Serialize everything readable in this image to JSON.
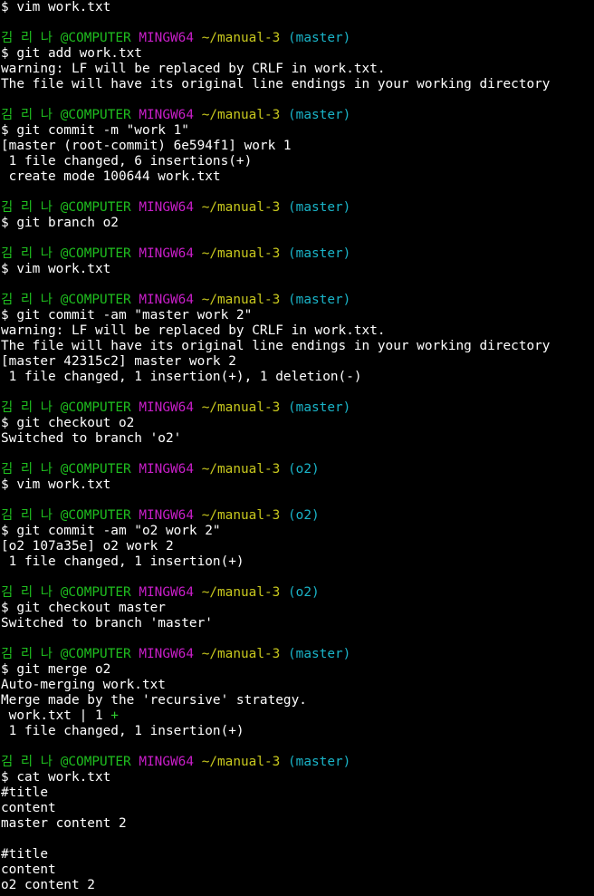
{
  "colors": {
    "background": "#000000",
    "text": "#ffffff",
    "user": "#1fbf1f",
    "system": "#c81ec8",
    "path": "#c8c81e",
    "branch": "#1ab4c8",
    "diffstat_plus": "#2ec82e"
  },
  "terminal": {
    "lines": [
      {
        "type": "text",
        "text": "$ vim work.txt"
      },
      {
        "type": "blank"
      },
      {
        "type": "prompt",
        "user": "김 리 나 @COMPUTER",
        "system": "MINGW64",
        "path": "~/manual-3",
        "branch": "(master)"
      },
      {
        "type": "text",
        "text": "$ git add work.txt"
      },
      {
        "type": "text",
        "text": "warning: LF will be replaced by CRLF in work.txt."
      },
      {
        "type": "text",
        "text": "The file will have its original line endings in your working directory"
      },
      {
        "type": "blank"
      },
      {
        "type": "prompt",
        "user": "김 리 나 @COMPUTER",
        "system": "MINGW64",
        "path": "~/manual-3",
        "branch": "(master)"
      },
      {
        "type": "text",
        "text": "$ git commit -m \"work 1\""
      },
      {
        "type": "text",
        "text": "[master (root-commit) 6e594f1] work 1"
      },
      {
        "type": "text",
        "text": " 1 file changed, 6 insertions(+)"
      },
      {
        "type": "text",
        "text": " create mode 100644 work.txt"
      },
      {
        "type": "blank"
      },
      {
        "type": "prompt",
        "user": "김 리 나 @COMPUTER",
        "system": "MINGW64",
        "path": "~/manual-3",
        "branch": "(master)"
      },
      {
        "type": "text",
        "text": "$ git branch o2"
      },
      {
        "type": "blank"
      },
      {
        "type": "prompt",
        "user": "김 리 나 @COMPUTER",
        "system": "MINGW64",
        "path": "~/manual-3",
        "branch": "(master)"
      },
      {
        "type": "text",
        "text": "$ vim work.txt"
      },
      {
        "type": "blank"
      },
      {
        "type": "prompt",
        "user": "김 리 나 @COMPUTER",
        "system": "MINGW64",
        "path": "~/manual-3",
        "branch": "(master)"
      },
      {
        "type": "text",
        "text": "$ git commit -am \"master work 2\""
      },
      {
        "type": "text",
        "text": "warning: LF will be replaced by CRLF in work.txt."
      },
      {
        "type": "text",
        "text": "The file will have its original line endings in your working directory"
      },
      {
        "type": "text",
        "text": "[master 42315c2] master work 2"
      },
      {
        "type": "text",
        "text": " 1 file changed, 1 insertion(+), 1 deletion(-)"
      },
      {
        "type": "blank"
      },
      {
        "type": "prompt",
        "user": "김 리 나 @COMPUTER",
        "system": "MINGW64",
        "path": "~/manual-3",
        "branch": "(master)"
      },
      {
        "type": "text",
        "text": "$ git checkout o2"
      },
      {
        "type": "text",
        "text": "Switched to branch 'o2'"
      },
      {
        "type": "blank"
      },
      {
        "type": "prompt",
        "user": "김 리 나 @COMPUTER",
        "system": "MINGW64",
        "path": "~/manual-3",
        "branch": "(o2)"
      },
      {
        "type": "text",
        "text": "$ vim work.txt"
      },
      {
        "type": "blank"
      },
      {
        "type": "prompt",
        "user": "김 리 나 @COMPUTER",
        "system": "MINGW64",
        "path": "~/manual-3",
        "branch": "(o2)"
      },
      {
        "type": "text",
        "text": "$ git commit -am \"o2 work 2\""
      },
      {
        "type": "text",
        "text": "[o2 107a35e] o2 work 2"
      },
      {
        "type": "text",
        "text": " 1 file changed, 1 insertion(+)"
      },
      {
        "type": "blank"
      },
      {
        "type": "prompt",
        "user": "김 리 나 @COMPUTER",
        "system": "MINGW64",
        "path": "~/manual-3",
        "branch": "(o2)"
      },
      {
        "type": "text",
        "text": "$ git checkout master"
      },
      {
        "type": "text",
        "text": "Switched to branch 'master'"
      },
      {
        "type": "blank"
      },
      {
        "type": "prompt",
        "user": "김 리 나 @COMPUTER",
        "system": "MINGW64",
        "path": "~/manual-3",
        "branch": "(master)"
      },
      {
        "type": "text",
        "text": "$ git merge o2"
      },
      {
        "type": "text",
        "text": "Auto-merging work.txt"
      },
      {
        "type": "text",
        "text": "Merge made by the 'recursive' strategy."
      },
      {
        "type": "diffstat",
        "text": " work.txt | 1 ",
        "plus": "+"
      },
      {
        "type": "text",
        "text": " 1 file changed, 1 insertion(+)"
      },
      {
        "type": "blank"
      },
      {
        "type": "prompt",
        "user": "김 리 나 @COMPUTER",
        "system": "MINGW64",
        "path": "~/manual-3",
        "branch": "(master)"
      },
      {
        "type": "text",
        "text": "$ cat work.txt"
      },
      {
        "type": "text",
        "text": "#title"
      },
      {
        "type": "text",
        "text": "content"
      },
      {
        "type": "text",
        "text": "master content 2"
      },
      {
        "type": "blank"
      },
      {
        "type": "text",
        "text": "#title"
      },
      {
        "type": "text",
        "text": "content"
      },
      {
        "type": "text",
        "text": "o2 content 2"
      }
    ]
  }
}
